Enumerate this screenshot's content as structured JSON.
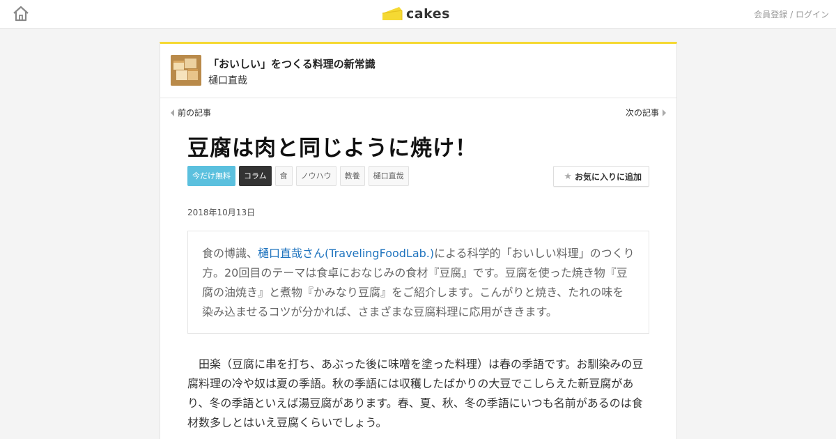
{
  "header": {
    "logo_text": "cakes",
    "register_label": "会員登録",
    "separator": " / ",
    "login_label": "ログイン"
  },
  "series": {
    "title": "「おいしい」をつくる料理の新常識",
    "author": "樋口直哉"
  },
  "nav": {
    "prev_label": "前の記事",
    "next_label": "次の記事"
  },
  "article": {
    "title": "豆腐は肉と同じように焼け！",
    "tags": [
      "今だけ無料",
      "コラム",
      "食",
      "ノウハウ",
      "教養",
      "樋口直哉"
    ],
    "favorite_label": "お気に入りに追加",
    "date": "2018年10月13日",
    "lead_before": "食の博識、",
    "lead_link": "樋口直哉さん(TravelingFoodLab.)",
    "lead_after": "による科学的「おいしい料理」のつくり方。20回目のテーマは食卓におなじみの食材『豆腐』です。豆腐を使った焼き物『豆腐の油焼き』と煮物『かみなり豆腐』をご紹介します。こんがりと焼き、たれの味を染み込ませるコツが分かれば、さまざまな豆腐料理に応用がききます。",
    "body": "　田楽（豆腐に串を打ち、あぶった後に味噌を塗った料理）は春の季語です。お馴染みの豆腐料理の冷や奴は夏の季語。秋の季語には収穫したばかりの大豆でこしらえた新豆腐があり、冬の季語といえば湯豆腐があります。春、夏、秋、冬の季語にいつも名前があるのは食材数多しとはいえ豆腐くらいでしょう。"
  },
  "colors": {
    "accent_yellow": "#f5d933",
    "free_tag": "#5bc0de",
    "link_blue": "#1e73be"
  },
  "icons": [
    "home-icon",
    "cakes-logo-icon",
    "chevron-left-icon",
    "chevron-right-icon",
    "star-icon"
  ]
}
